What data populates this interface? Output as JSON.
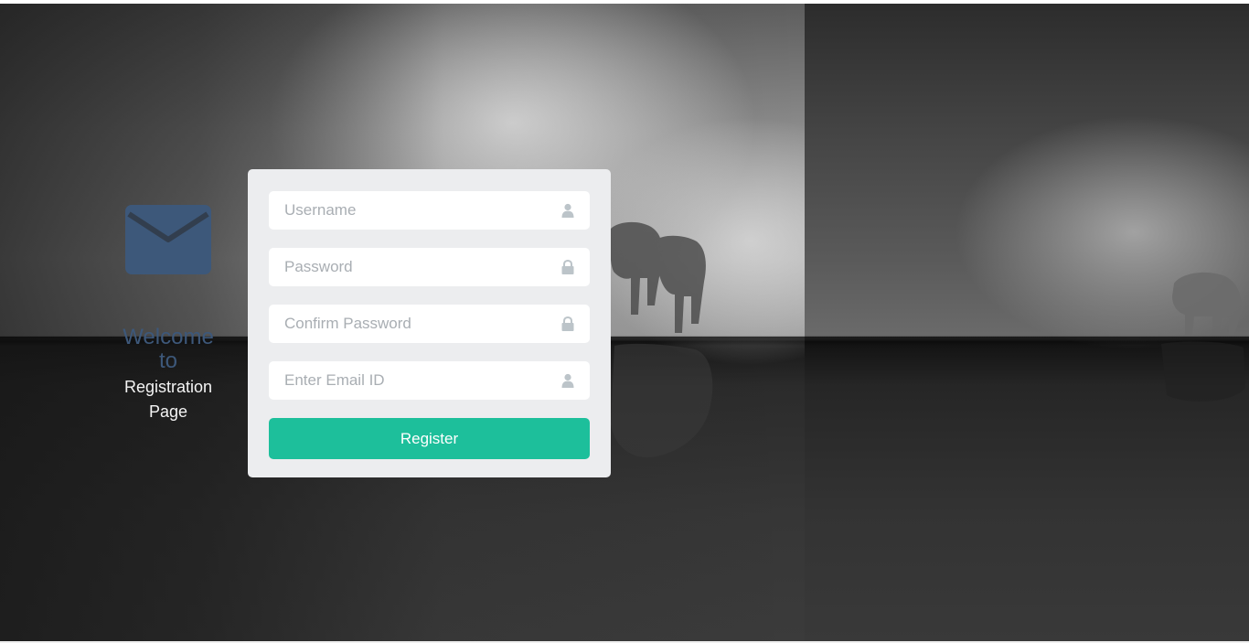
{
  "welcome": {
    "line1": "Welcome",
    "line2": "to",
    "line3": "Registration",
    "line4": "Page",
    "icon": "envelope-icon"
  },
  "form": {
    "fields": [
      {
        "placeholder": "Username",
        "icon": "user-icon"
      },
      {
        "placeholder": "Password",
        "icon": "lock-icon"
      },
      {
        "placeholder": "Confirm Password",
        "icon": "lock-icon"
      },
      {
        "placeholder": "Enter Email ID",
        "icon": "user-icon"
      }
    ],
    "submit_label": "Register"
  },
  "colors": {
    "accent": "#1dbf9b",
    "card_bg": "#ecedef",
    "envelope": "#3d587a",
    "placeholder": "#a9aeb3",
    "field_icon": "#bcc4c9"
  }
}
